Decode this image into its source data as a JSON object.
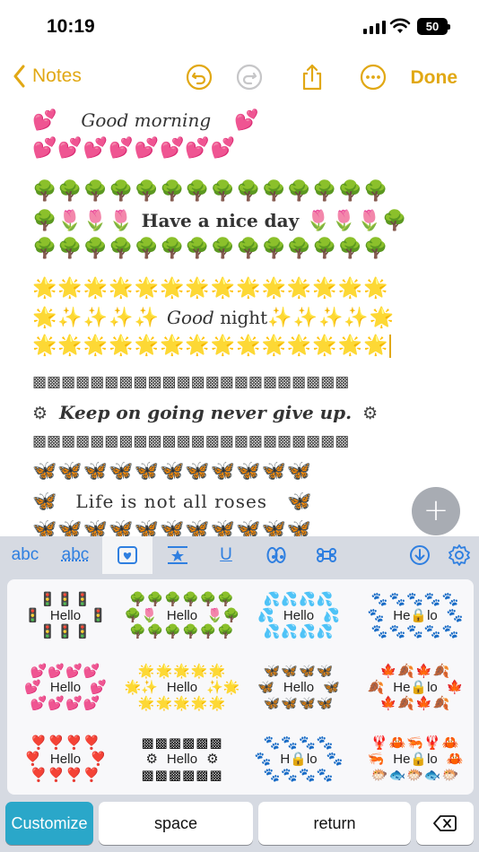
{
  "status": {
    "time": "10:19",
    "battery": "50"
  },
  "nav": {
    "back_label": "Notes",
    "done_label": "Done"
  },
  "note": {
    "greet1_pre": "💕 ",
    "greet1_text": "Good morning",
    "greet1_post": " 💕",
    "greet1_row2": "💕💕💕💕💕💕💕💕",
    "trees_row": "🌳🌳🌳🌳🌳🌳🌳🌳🌳🌳🌳🌳🌳🌳",
    "nice_pre": "🌳🌷🌷🌷 ",
    "nice_text": "Have a nice day",
    "nice_post": " 🌷🌷🌷🌳",
    "stars_row": "🌟🌟🌟🌟🌟🌟🌟🌟🌟🌟🌟🌟🌟🌟",
    "night_pre": "🌟✨✨✨✨ ",
    "night_text_a": "Good",
    "night_text_b": " night",
    "night_post": "✨✨✨✨🌟",
    "deco_row": "▩▩▩▩▩▩▩▩▩▩▩▩▩▩▩▩▩▩▩▩▩▩",
    "keep_pre": "⚙",
    "keep_text": "Keep on going never give up.",
    "keep_post": "⚙",
    "bfly_row": "🦋🦋🦋🦋🦋🦋🦋🦋🦋🦋🦋",
    "roses_pre": "🦋",
    "roses_text": "Life is not all roses",
    "roses_post": "🦋"
  },
  "tabs": {
    "abc": "abc",
    "abc2": "abc"
  },
  "grid": {
    "cells": [
      {
        "top": "🚦🚦🚦",
        "left": "🚦",
        "mid": "Hello",
        "right": "🚦",
        "bottom": "🚦🚦🚦"
      },
      {
        "top": "🌳🌳🌳🌳🌳🌳",
        "left": "🌳🌷",
        "mid": "Hello",
        "right": "🌷🌳",
        "bottom": "🌳🌳🌳🌳🌳🌳"
      },
      {
        "top": "💦💦💦💦",
        "left": "💦",
        "mid": "Hello",
        "right": "💦",
        "bottom": "💦💦💦💦"
      },
      {
        "top": "🐾🐾🐾🐾🐾",
        "left": "🐾",
        "mid": "He🔒lo",
        "right": "🐾",
        "bottom": "🐾🐾🐾🐾🐾"
      },
      {
        "top": "💕💕💕💕",
        "left": "💕",
        "mid": "Hello",
        "right": "💕",
        "bottom": "💕💕💕💕"
      },
      {
        "top": "🌟🌟🌟🌟🌟",
        "left": "🌟✨",
        "mid": "Hello",
        "right": "✨🌟",
        "bottom": "🌟🌟🌟🌟🌟"
      },
      {
        "top": "🦋🦋🦋🦋",
        "left": "🦋",
        "mid": "Hello",
        "right": "🦋",
        "bottom": "🦋🦋🦋🦋"
      },
      {
        "top": "🍁🍂🍁🍂",
        "left": "🍂",
        "mid": "He🔒lo",
        "right": "🍁",
        "bottom": "🍁🍂🍁🍂"
      },
      {
        "top": "❣️❣️❣️❣️",
        "left": "❣️",
        "mid": "Hello",
        "right": "❣️",
        "bottom": "❣️❣️❣️❣️"
      },
      {
        "top": "▩▩▩▩▩▩",
        "left": "⚙",
        "mid": "Hello",
        "right": "⚙",
        "bottom": "▩▩▩▩▩▩"
      },
      {
        "top": "🐾🐾🐾🐾",
        "left": "🐾",
        "mid": "H🔒lo",
        "right": "🐾",
        "bottom": "🐾🐾🐾🐾"
      },
      {
        "top": "🦞🦀🦐🦞🦀",
        "left": "🦐",
        "mid": "He🔒lo",
        "right": "🦀",
        "bottom": "🐡🐟🐡🐟🐡"
      }
    ]
  },
  "buttons": {
    "customize": "Customize",
    "space": "space",
    "return": "return"
  },
  "colors": {
    "accent": "#e1a814",
    "keyboard_blue": "#2f7fe0",
    "customize_bg": "#2aa7c9"
  }
}
